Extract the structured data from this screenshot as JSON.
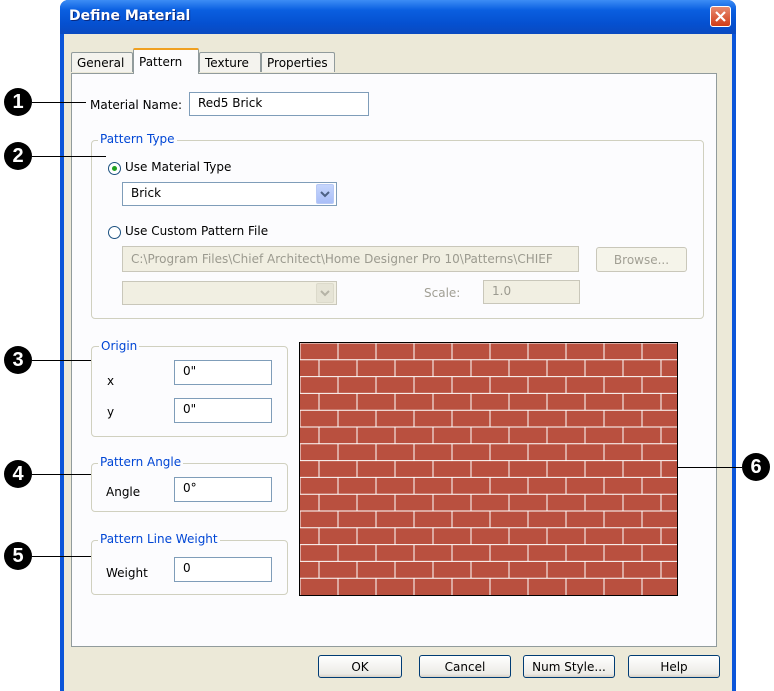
{
  "window": {
    "title": "Define Material"
  },
  "tabs": [
    {
      "label": "General",
      "active": false
    },
    {
      "label": "Pattern",
      "active": true
    },
    {
      "label": "Texture",
      "active": false
    },
    {
      "label": "Properties",
      "active": false
    }
  ],
  "material_name": {
    "label": "Material Name:",
    "value": "Red5 Brick"
  },
  "pattern_type": {
    "legend": "Pattern Type",
    "use_material_type": {
      "label": "Use Material Type",
      "selected": true
    },
    "material_type_select": {
      "value": "Brick"
    },
    "use_custom_file": {
      "label": "Use Custom Pattern File",
      "selected": false
    },
    "file_path": "C:\\Program Files\\Chief Architect\\Home Designer Pro 10\\Patterns\\CHIEF",
    "browse_label": "Browse...",
    "scale_label": "Scale:",
    "scale_value": "1.0"
  },
  "origin": {
    "legend": "Origin",
    "x_label": "x",
    "x_value": "0\"",
    "y_label": "y",
    "y_value": "0\""
  },
  "pattern_angle": {
    "legend": "Pattern Angle",
    "label": "Angle",
    "value": "0°"
  },
  "line_weight": {
    "legend": "Pattern Line Weight",
    "label": "Weight",
    "value": "0"
  },
  "preview": {
    "brick_color": "#b9503f",
    "mortar_color": "#ffffff"
  },
  "buttons": {
    "ok": "OK",
    "cancel": "Cancel",
    "num_style": "Num Style...",
    "help": "Help"
  },
  "callouts": [
    "1",
    "2",
    "3",
    "4",
    "5",
    "6"
  ],
  "colors": {
    "title_bar": "#0a5fe0",
    "legend_text": "#0046d5",
    "dialog_bg": "#ece9d8",
    "close_button": "#d03c16"
  }
}
